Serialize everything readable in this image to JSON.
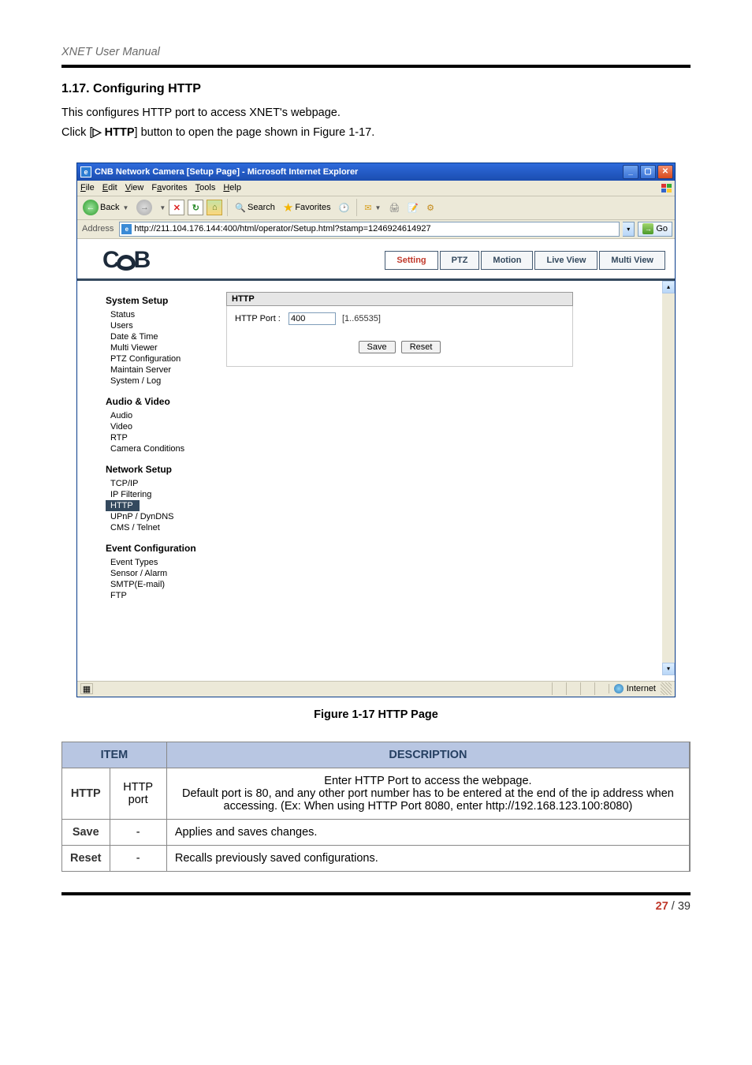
{
  "doc": {
    "header": "XNET User Manual",
    "section_title": "1.17. Configuring HTTP",
    "intro1": "This configures HTTP port to access XNET's webpage.",
    "intro2_pre": "Click [",
    "intro2_btn": "▷ HTTP",
    "intro2_post": "] button to open the page shown in Figure 1-17.",
    "figure_caption": "Figure 1-17 HTTP Page",
    "page_current": "27",
    "page_sep": " / ",
    "page_total": "39"
  },
  "browser": {
    "title": "CNB Network Camera [Setup Page] - Microsoft Internet Explorer",
    "menu": {
      "file": "File",
      "edit": "Edit",
      "view": "View",
      "favorites": "Favorites",
      "tools": "Tools",
      "help": "Help"
    },
    "toolbar": {
      "back": "Back",
      "search": "Search",
      "favorites": "Favorites"
    },
    "address_label": "Address",
    "address_url": "http://211.104.176.144:400/html/operator/Setup.html?stamp=1246924614927",
    "go": "Go",
    "status_zone": "Internet"
  },
  "app": {
    "logo": "CNB",
    "tabs": {
      "setting": "Setting",
      "ptz": "PTZ",
      "motion": "Motion",
      "liveview": "Live View",
      "multiview": "Multi View"
    },
    "sidebar": {
      "g1": "System Setup",
      "g1_items": [
        "Status",
        "Users",
        "Date & Time",
        "Multi Viewer",
        "PTZ Configuration",
        "Maintain Server",
        "System / Log"
      ],
      "g2": "Audio & Video",
      "g2_items": [
        "Audio",
        "Video",
        "RTP",
        "Camera Conditions"
      ],
      "g3": "Network Setup",
      "g3_items": [
        "TCP/IP",
        "IP Filtering",
        "HTTP",
        "UPnP / DynDNS",
        "CMS / Telnet"
      ],
      "g4": "Event Configuration",
      "g4_items": [
        "Event Types",
        "Sensor / Alarm",
        "SMTP(E-mail)",
        "FTP"
      ]
    },
    "panel": {
      "title": "HTTP",
      "port_label": "HTTP Port :",
      "port_value": "400",
      "port_hint": "[1..65535]",
      "save": "Save",
      "reset": "Reset"
    }
  },
  "table": {
    "head_item": "ITEM",
    "head_desc": "DESCRIPTION",
    "rows": [
      {
        "c1": "HTTP",
        "c2": "HTTP port",
        "c3": "Enter HTTP Port to access the webpage.\nDefault port is 80, and any other port number has to be entered at the end of the ip address when accessing. (Ex: When using HTTP Port 8080, enter http://192.168.123.100:8080)",
        "center": true
      },
      {
        "c1": "Save",
        "c2": "-",
        "c3": "Applies and saves changes."
      },
      {
        "c1": "Reset",
        "c2": "-",
        "c3": "Recalls previously saved configurations."
      }
    ]
  }
}
